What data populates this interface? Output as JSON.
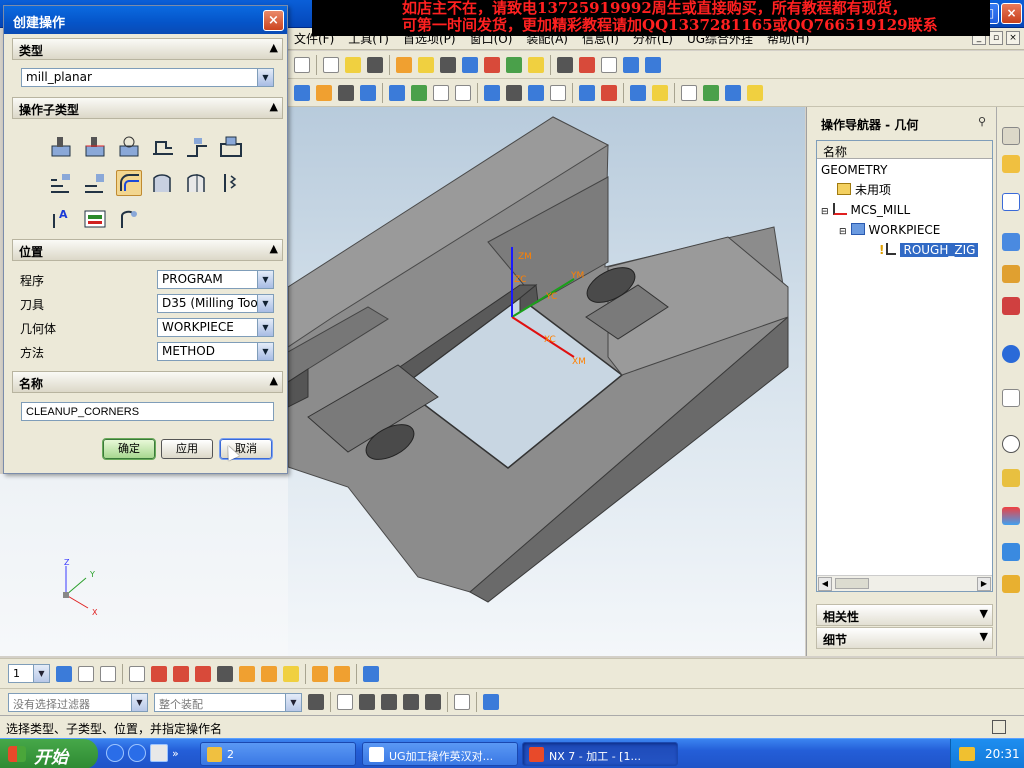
{
  "promo": {
    "line1": "如店主不在，请致电13725919992周生或直接购买，所有教程都有现货，",
    "line2": "可第一时间发货，更加精彩教程请加QQ1337281165或QQ766519129联系"
  },
  "menu": [
    "文件(F)",
    "工具(T)",
    "首选项(P)",
    "窗口(O)",
    "装配(A)",
    "信息(I)",
    "分析(L)",
    "UG综合外挂",
    "帮助(H)"
  ],
  "viewport": {
    "csys_labels": {
      "zm": "ZM",
      "ym": "YM",
      "xm": "XM",
      "zc": "ZC",
      "yc": "YC",
      "xc": "XC"
    },
    "triad": {
      "z": "Z",
      "y": "Y",
      "x": "X"
    }
  },
  "navigator": {
    "title": "操作导航器 - 几何",
    "column_header": "名称",
    "tree": [
      {
        "label": "GEOMETRY"
      },
      {
        "label": "未用项"
      },
      {
        "label": "MCS_MILL"
      },
      {
        "label": "WORKPIECE"
      },
      {
        "label": "ROUGH_ZIG"
      }
    ],
    "sections": [
      "相关性",
      "细节"
    ]
  },
  "bottom_toolbar": {
    "layer_value": "1",
    "filter_placeholder": "没有选择过滤器",
    "assembly_placeholder": "整个装配"
  },
  "status_bar": {
    "message": "选择类型、子类型、位置，并指定操作名"
  },
  "taskbar": {
    "start_label": "开始",
    "chevron": "»",
    "tasks": [
      "2",
      "UG加工操作英汉对...",
      "NX 7 - 加工 - [1..."
    ],
    "clock": "20:31"
  },
  "dialog": {
    "title": "创建操作",
    "type_group": "类型",
    "type_value": "mill_planar",
    "subtype_group": "操作子类型",
    "location_group": "位置",
    "fields": [
      {
        "label": "程序",
        "value": "PROGRAM"
      },
      {
        "label": "刀具",
        "value": "D35 (Milling Tool"
      },
      {
        "label": "几何体",
        "value": "WORKPIECE"
      },
      {
        "label": "方法",
        "value": "METHOD"
      }
    ],
    "name_group": "名称",
    "name_value": "CLEANUP_CORNERS",
    "buttons": {
      "ok": "确定",
      "apply": "应用",
      "cancel": "取消"
    }
  },
  "colors": {
    "xp_blue": "#0554c8",
    "selection": "#316ac5",
    "promo_text": "#ff2020",
    "part_gray": "#8a8a8a"
  }
}
